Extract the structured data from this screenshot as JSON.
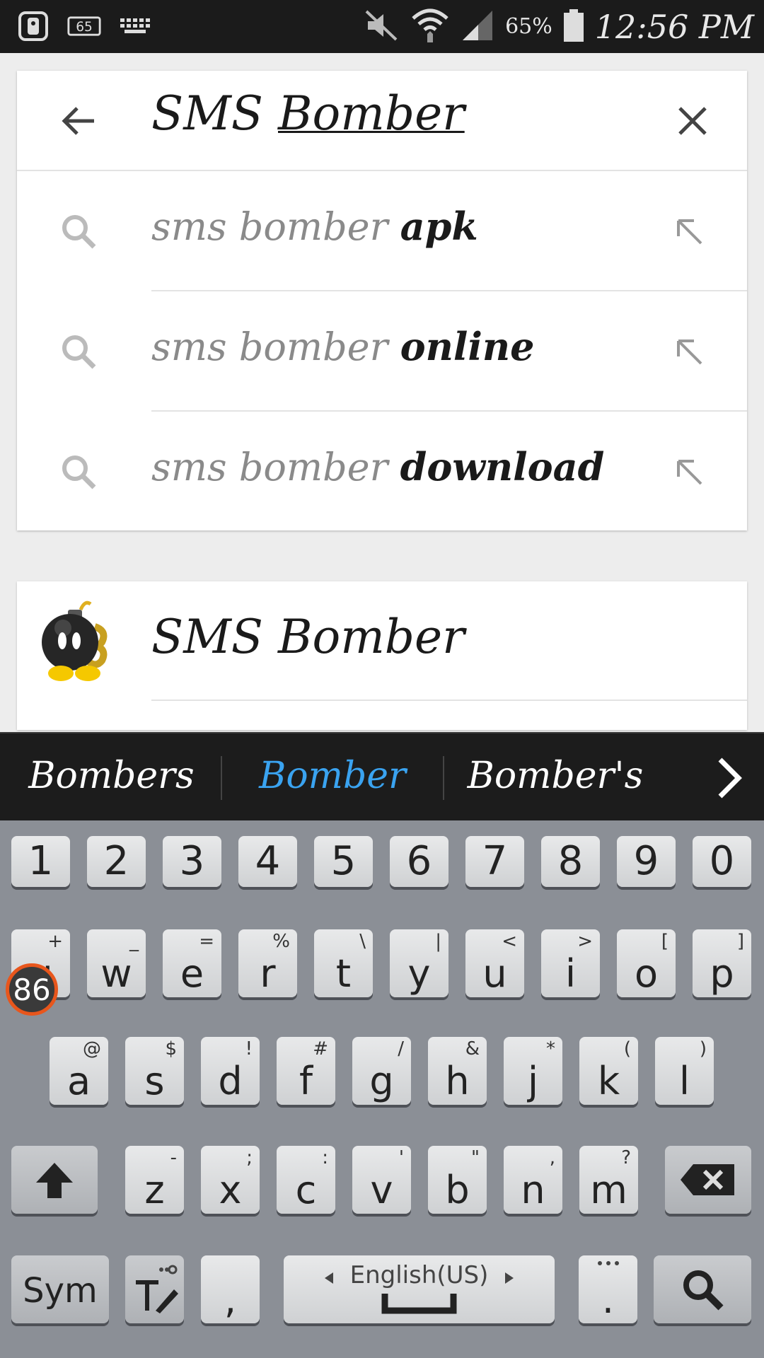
{
  "status_bar": {
    "left_icons": [
      "remote-icon",
      "notification-65-icon",
      "keyboard-icon"
    ],
    "notification_count": "65",
    "battery_percent": "65%",
    "time": "12:56 PM",
    "right_icons": [
      "mute-icon",
      "wifi-icon",
      "signal-icon",
      "battery-icon"
    ]
  },
  "search": {
    "query_prefix": "SMS ",
    "query_underlined": "Bomber",
    "back_icon": "arrow-left-icon",
    "clear_icon": "close-icon"
  },
  "suggestions": [
    {
      "prefix": "sms bomber ",
      "completion": "apk"
    },
    {
      "prefix": "sms bomber ",
      "completion": "online"
    },
    {
      "prefix": "sms bomber ",
      "completion": "download"
    }
  ],
  "result": {
    "title": "SMS Bomber",
    "icon": "bomb-app-icon"
  },
  "word_suggestions": {
    "items": [
      "Bombers",
      "Bomber",
      "Bomber's"
    ],
    "highlight_color": "#3aa3f0"
  },
  "keyboard": {
    "number_row": [
      "1",
      "2",
      "3",
      "4",
      "5",
      "6",
      "7",
      "8",
      "9",
      "0"
    ],
    "row1": [
      {
        "k": "q",
        "s": "+"
      },
      {
        "k": "w",
        "s": "_"
      },
      {
        "k": "e",
        "s": "="
      },
      {
        "k": "r",
        "s": "%"
      },
      {
        "k": "t",
        "s": "\\"
      },
      {
        "k": "y",
        "s": "|"
      },
      {
        "k": "u",
        "s": "<"
      },
      {
        "k": "i",
        "s": ">"
      },
      {
        "k": "o",
        "s": "["
      },
      {
        "k": "p",
        "s": "]"
      }
    ],
    "row2": [
      {
        "k": "a",
        "s": "@"
      },
      {
        "k": "s",
        "s": "$"
      },
      {
        "k": "d",
        "s": "!"
      },
      {
        "k": "f",
        "s": "#"
      },
      {
        "k": "g",
        "s": "/"
      },
      {
        "k": "h",
        "s": "&"
      },
      {
        "k": "j",
        "s": "*"
      },
      {
        "k": "k",
        "s": "("
      },
      {
        "k": "l",
        "s": ")"
      }
    ],
    "row3": [
      {
        "k": "z",
        "s": "-"
      },
      {
        "k": "x",
        "s": ";"
      },
      {
        "k": "c",
        "s": ":"
      },
      {
        "k": "v",
        "s": "'"
      },
      {
        "k": "b",
        "s": "\""
      },
      {
        "k": "n",
        "s": ","
      },
      {
        "k": "m",
        "s": "?"
      }
    ],
    "sym_label": "Sym",
    "comma_label": ",",
    "space_language": "English(US)",
    "period_label": ".",
    "badge_count": "86"
  }
}
